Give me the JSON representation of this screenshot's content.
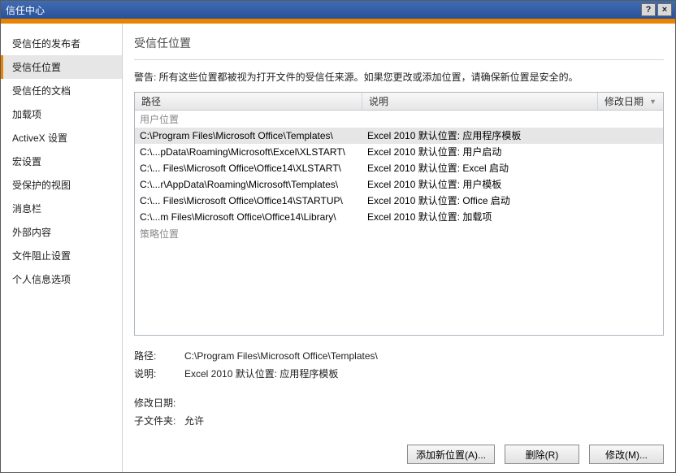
{
  "window": {
    "title": "信任中心",
    "help_label": "?",
    "close_label": "×"
  },
  "sidebar": {
    "items": [
      {
        "label": "受信任的发布者"
      },
      {
        "label": "受信任位置",
        "selected": true
      },
      {
        "label": "受信任的文档"
      },
      {
        "label": "加载项"
      },
      {
        "label": "ActiveX 设置"
      },
      {
        "label": "宏设置"
      },
      {
        "label": "受保护的视图"
      },
      {
        "label": "消息栏"
      },
      {
        "label": "外部内容"
      },
      {
        "label": "文件阻止设置"
      },
      {
        "label": "个人信息选项"
      }
    ]
  },
  "main": {
    "heading": "受信任位置",
    "warning": "警告: 所有这些位置都被视为打开文件的受信任来源。如果您更改或添加位置，请确保新位置是安全的。",
    "columns": {
      "path": "路径",
      "desc": "说明",
      "date": "修改日期"
    },
    "groups": [
      {
        "name": "用户位置",
        "rows": [
          {
            "path": "C:\\Program Files\\Microsoft Office\\Templates\\",
            "desc": "Excel 2010 默认位置: 应用程序模板",
            "date": "",
            "selected": true
          },
          {
            "path": "C:\\...pData\\Roaming\\Microsoft\\Excel\\XLSTART\\",
            "desc": "Excel 2010 默认位置: 用户启动",
            "date": ""
          },
          {
            "path": "C:\\... Files\\Microsoft Office\\Office14\\XLSTART\\",
            "desc": "Excel 2010 默认位置: Excel 启动",
            "date": ""
          },
          {
            "path": "C:\\...r\\AppData\\Roaming\\Microsoft\\Templates\\",
            "desc": "Excel 2010 默认位置: 用户模板",
            "date": ""
          },
          {
            "path": "C:\\... Files\\Microsoft Office\\Office14\\STARTUP\\",
            "desc": "Excel 2010 默认位置: Office 启动",
            "date": ""
          },
          {
            "path": "C:\\...m Files\\Microsoft Office\\Office14\\Library\\",
            "desc": "Excel 2010 默认位置: 加载项",
            "date": ""
          }
        ]
      },
      {
        "name": "策略位置",
        "rows": []
      }
    ],
    "details": {
      "path_label": "路径:",
      "path_value": "C:\\Program Files\\Microsoft Office\\Templates\\",
      "desc_label": "说明:",
      "desc_value": "Excel 2010 默认位置: 应用程序模板",
      "date_label": "修改日期:",
      "date_value": "",
      "sub_label": "子文件夹:",
      "sub_value": "允许"
    },
    "buttons": {
      "add": "添加新位置(A)...",
      "remove": "删除(R)",
      "modify": "修改(M)..."
    }
  }
}
